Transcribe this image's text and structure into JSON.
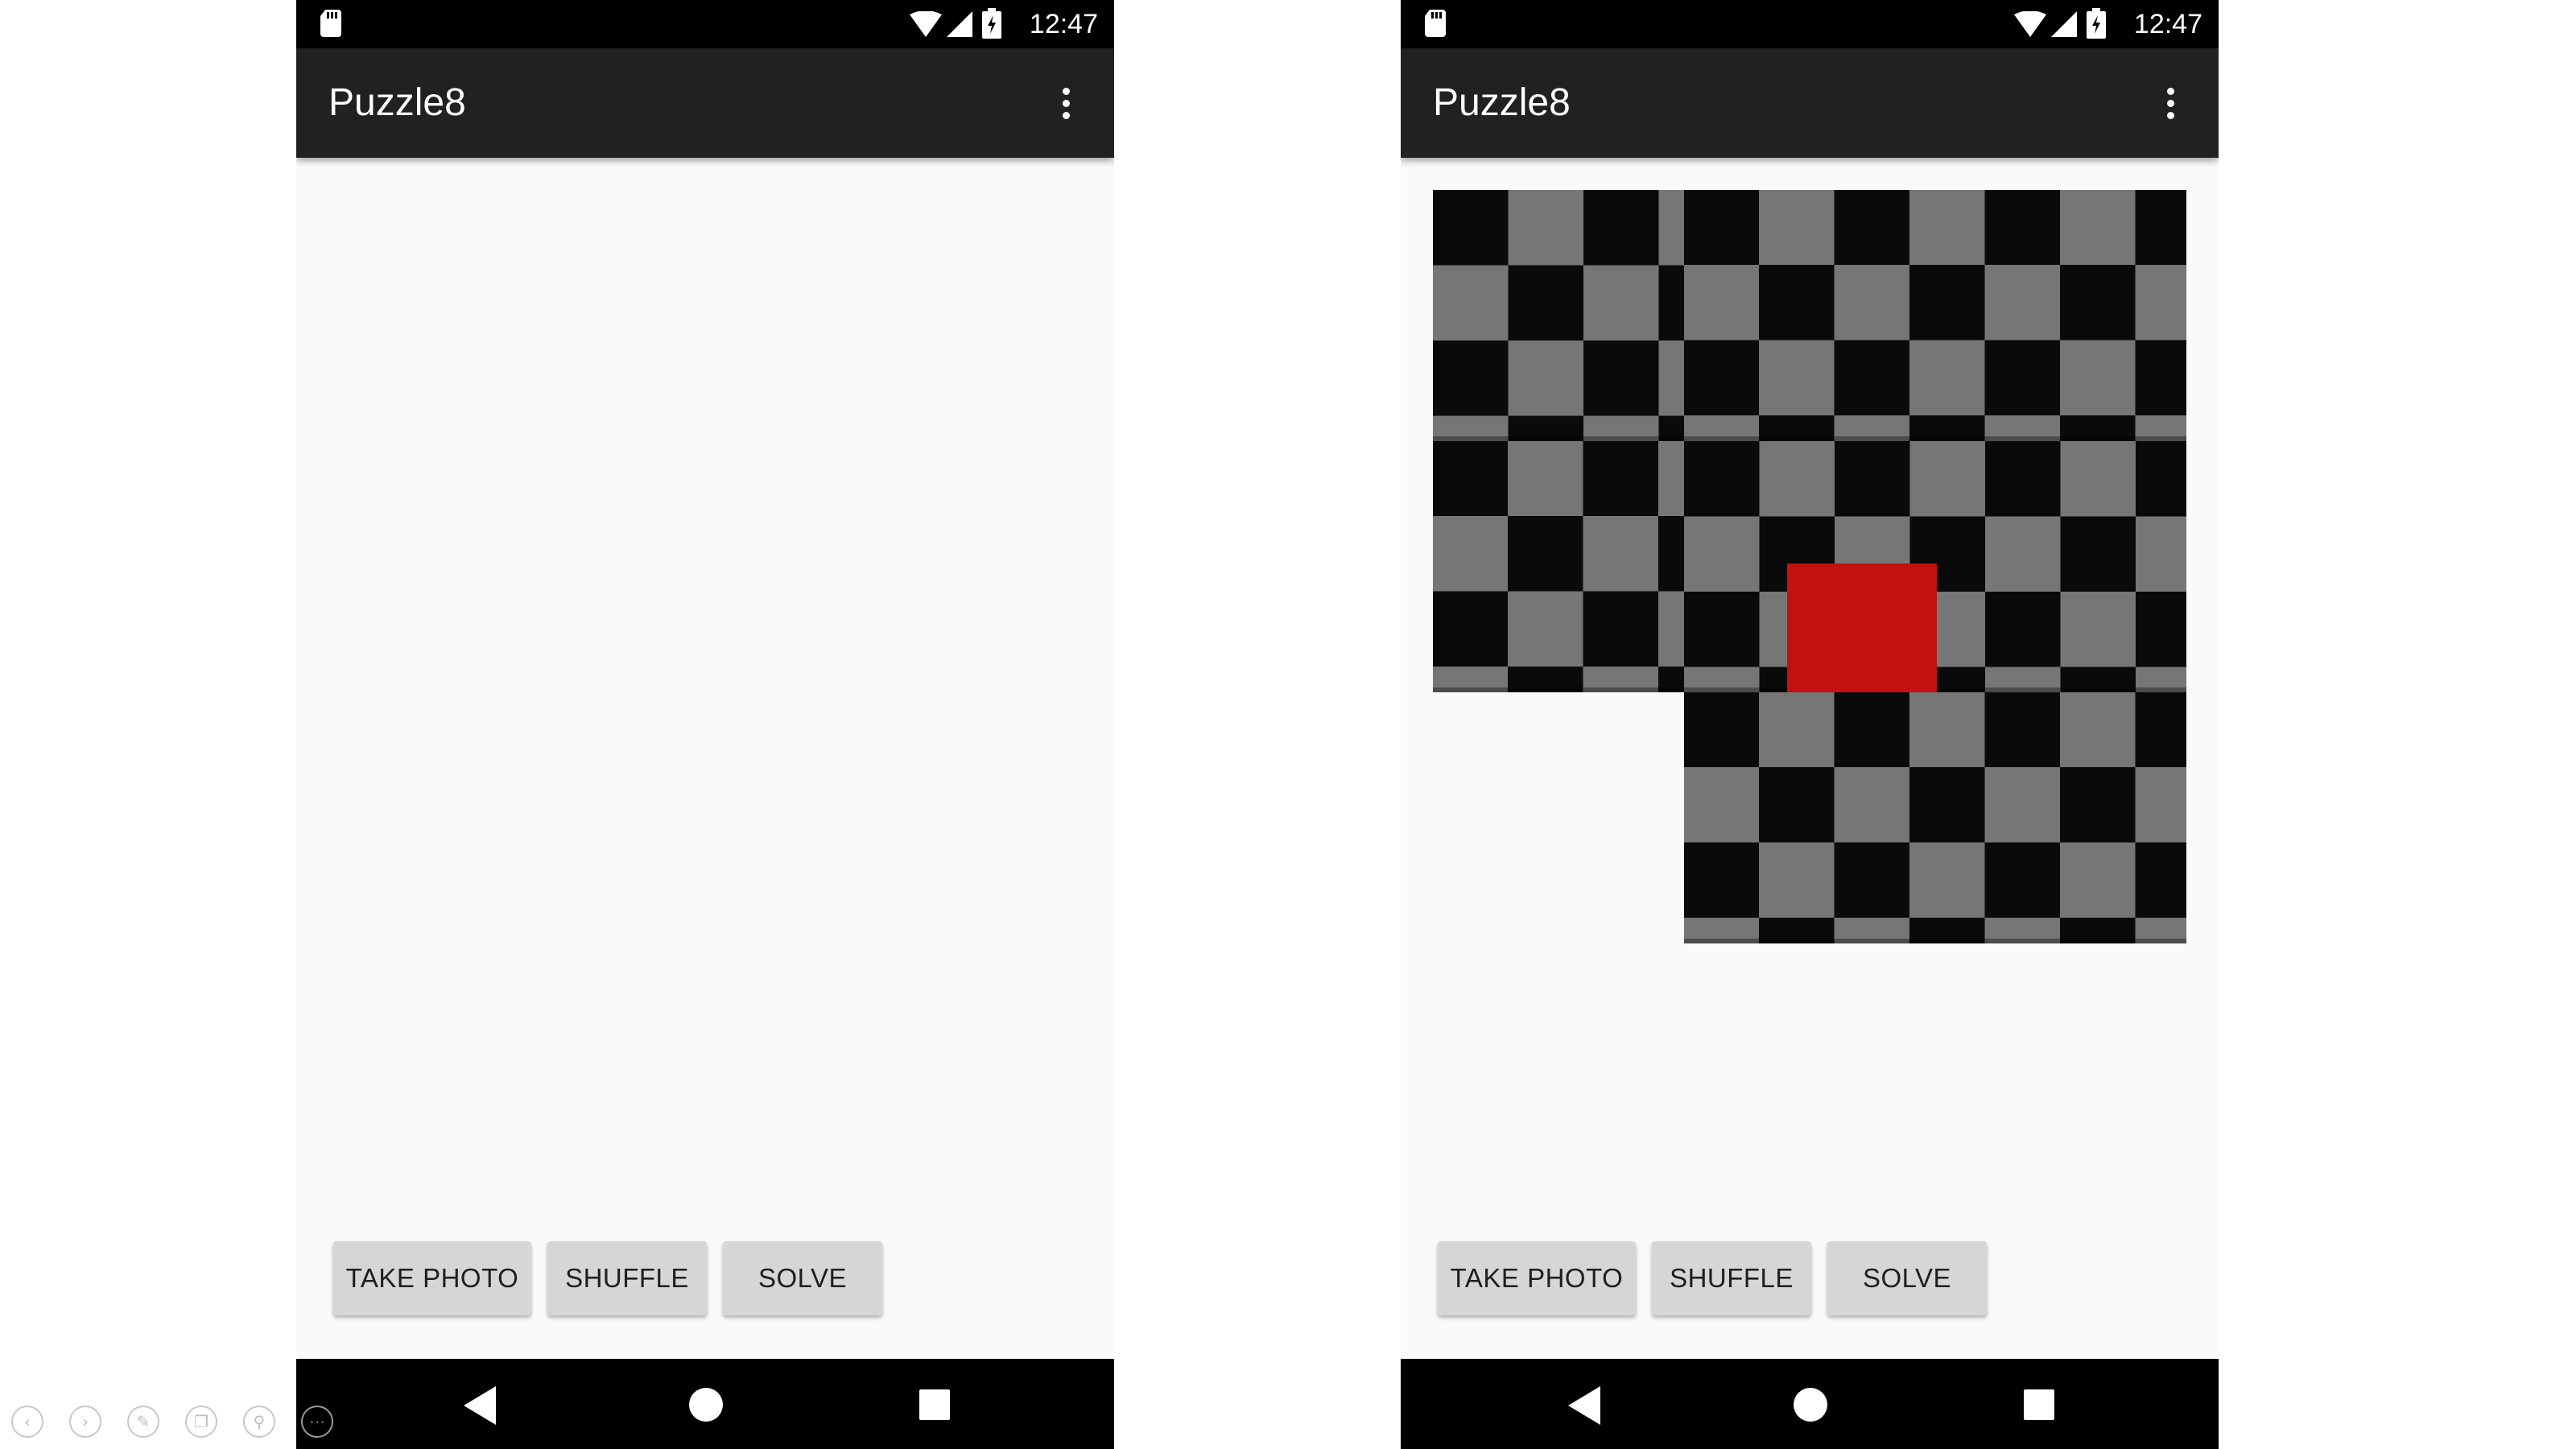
{
  "screens": [
    {
      "status_bar": {
        "time": "12:47"
      },
      "app_bar": {
        "title": "Puzzle8"
      },
      "puzzle_visible": false,
      "buttons": {
        "take_photo": "TAKE PHOTO",
        "shuffle": "SHUFFLE",
        "solve": "SOLVE"
      }
    },
    {
      "status_bar": {
        "time": "12:47"
      },
      "app_bar": {
        "title": "Puzzle8"
      },
      "puzzle_visible": true,
      "buttons": {
        "take_photo": "TAKE PHOTO",
        "shuffle": "SHUFFLE",
        "solve": "SOLVE"
      }
    }
  ],
  "icons": {
    "status": [
      "sd-card-icon",
      "wifi-icon",
      "signal-icon",
      "battery-charging-icon"
    ],
    "app_bar": [
      "overflow-menu-icon"
    ],
    "nav": [
      "back-icon",
      "home-icon",
      "recents-icon"
    ],
    "viewer": [
      "previous-icon",
      "next-icon",
      "edit-icon",
      "copy-icon",
      "zoom-icon",
      "more-icon"
    ]
  },
  "colors": {
    "status_bar": "#000000",
    "app_bar": "#212121",
    "background": "#fafafa",
    "button": "#d6d6d6",
    "tile_dark": "#0a0a0a",
    "tile_light": "#767676",
    "blank_tile": "#c51010"
  }
}
